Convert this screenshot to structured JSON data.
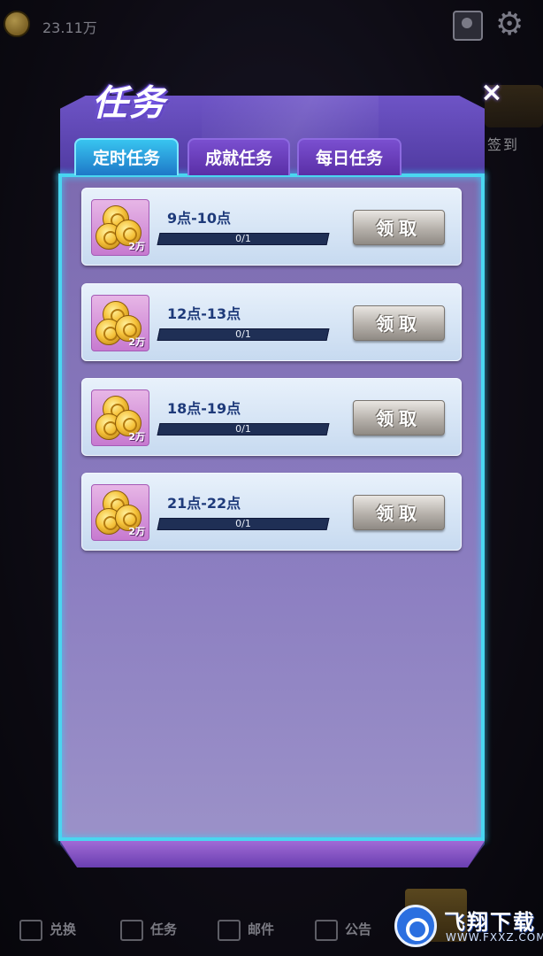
{
  "topbar": {
    "coin_amount": "23.11万"
  },
  "side": {
    "signin_label": "签到"
  },
  "dialog": {
    "title": "任务",
    "close_label": "×",
    "tabs": [
      {
        "label": "定时任务",
        "active": true
      },
      {
        "label": "成就任务",
        "active": false
      },
      {
        "label": "每日任务",
        "active": false
      }
    ],
    "tasks": [
      {
        "title": "9点-10点",
        "reward": "2万",
        "progress_text": "0/1",
        "progress": 0,
        "button": "领取"
      },
      {
        "title": "12点-13点",
        "reward": "2万",
        "progress_text": "0/1",
        "progress": 0,
        "button": "领取"
      },
      {
        "title": "18点-19点",
        "reward": "2万",
        "progress_text": "0/1",
        "progress": 0,
        "button": "领取"
      },
      {
        "title": "21点-22点",
        "reward": "2万",
        "progress_text": "0/1",
        "progress": 0,
        "button": "领取"
      }
    ]
  },
  "bottom_nav": {
    "items": [
      {
        "label": "兑换",
        "icon": "exchange-icon"
      },
      {
        "label": "任务",
        "icon": "task-icon"
      },
      {
        "label": "邮件",
        "icon": "mail-icon"
      },
      {
        "label": "公告",
        "icon": "notice-icon"
      }
    ]
  },
  "watermark": {
    "text": "飞翔下载",
    "url": "WWW.FXXZ.COM"
  },
  "colors": {
    "panel_purple": "#4b3794",
    "frame_cyan": "#4ad6f0",
    "active_tab": "#38c4f0",
    "task_title": "#1e3a7a"
  }
}
